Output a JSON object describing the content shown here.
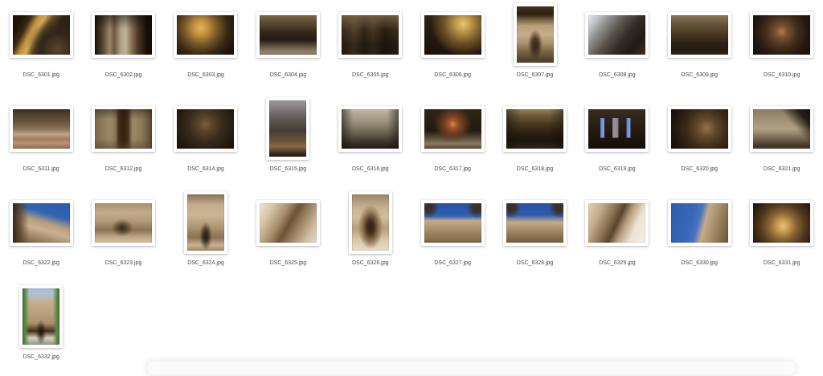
{
  "colors": {
    "page_background": "#ffffff",
    "card_background": "#ffffff",
    "label_text": "#4a4a4a"
  },
  "gallery": {
    "items": [
      {
        "filename": "DSC_6301.jpg",
        "orientation": "landscape",
        "bg": "radial-gradient(circle at 78% 85%, #5a4632 0%, #32261a 28%, rgba(0,0,0,0) 55%), linear-gradient(118deg, #1c120a 12%, #3a2a16 24%, #c08f3e 34%, #d4ab58 42%, #6b4e26 52%, #2e2114 66%, #241a10 100%)"
      },
      {
        "filename": "DSC_6302.jpg",
        "orientation": "landscape",
        "bg": "linear-gradient(180deg, rgba(12,8,5,0.5) 0%, rgba(0,0,0,0) 35%), linear-gradient(90deg, #1a100a 0%, #5a4632 14%, #9a8668 26%, #6b5840 34%, #b2a48c 46%, #c0b29a 54%, #8a7458 64%, #4a3624 76%, #140c06 92%)"
      },
      {
        "filename": "DSC_6303.jpg",
        "orientation": "landscape",
        "bg": "radial-gradient(circle at 42% 32%, #e2b558 0%, #c08f3e 18%, #7a5a28 38%, #3a2a16 62%, #1e140c 85%, #16100a 100%)"
      },
      {
        "filename": "DSC_6304.jpg",
        "orientation": "landscape",
        "bg": "linear-gradient(180deg, #7a6543 0%, #57452e 22%, #32261a 45%, #241a12 62%, #6b5c4a 82%, #93846e 94%, #7a6c58 100%)"
      },
      {
        "filename": "DSC_6305.jpg",
        "orientation": "landscape",
        "bg": "linear-gradient(180deg, rgba(122,101,70,0.85) 0%, rgba(62,48,32,0.2) 38%, rgba(20,13,8,0.5) 75%), linear-gradient(90deg, #32261a 0%, #57452e 22%, #2e2216 40%, #4a3a26 55%, #241a10 75%, #3a2c1c 100%)"
      },
      {
        "filename": "DSC_6306.jpg",
        "orientation": "landscape",
        "bg": "radial-gradient(circle at 68% 22%, #e8c870 0%, #b08a44 20%, #6b4e26 40%, rgba(0,0,0,0) 65%), linear-gradient(200deg, #4a3a22 0%, #2a1e12 45%, #18100a 100%)"
      },
      {
        "filename": "DSC_6307.jpg",
        "orientation": "portrait",
        "bg": "radial-gradient(ellipse at 50% 68%, rgba(52,34,18,0.95) 0%, rgba(52,34,18,0.8) 12%, rgba(0,0,0,0) 28%), linear-gradient(180deg, #44321e 0%, #302012 14%, #6b563a 22%, #b89e7a 34%, #c6ae8a 50%, #ae9572 64%, #7a6348 80%, #57432c 94%)"
      },
      {
        "filename": "DSC_6308.jpg",
        "orientation": "landscape",
        "bg": "linear-gradient(128deg, #e8eaec 0%, #c2c6ca 12%, #8a8a86 28%, #57524a 45%, #332c24 62%, #201a14 80%, #3a322a 100%)"
      },
      {
        "filename": "DSC_6309.jpg",
        "orientation": "landscape",
        "bg": "linear-gradient(180deg, #8a7656 0%, #6b583c 20%, #4a3a26 45%, #2e2216 70%, #241a10 88%, #32261a 100%)"
      },
      {
        "filename": "DSC_6310.jpg",
        "orientation": "landscape",
        "bg": "radial-gradient(circle at 50% 42%, #b07c48 0%, #7a5230 16%, #44301c 42%, #241812 70%, #160e08 100%)"
      },
      {
        "filename": "DSC_6311.jpg",
        "orientation": "landscape",
        "bg": "linear-gradient(180deg, #3a2c1c 0%, #57452e 18%, #6b5840 34%, #8a7456 50%, #c0a488 64%, #a87a5e 76%, #b89478 86%, #93674e 100%)"
      },
      {
        "filename": "DSC_6312.jpg",
        "orientation": "landscape",
        "bg": "linear-gradient(180deg, rgba(40,28,16,0.5) 0%, rgba(0,0,0,0) 25%, rgba(0,0,0,0) 75%, rgba(90,70,46,0.6) 100%), linear-gradient(90deg, #7a6848 0%, #9c8968 26%, #8a7656 36%, #442c16 42%, #32200e 50%, #442c16 58%, #9c8968 66%, #8a7656 84%, #57452e 100%)"
      },
      {
        "filename": "DSC_6314.jpg",
        "orientation": "landscape",
        "bg": "radial-gradient(circle at 50% 38%, #7a5e3c 0%, #57432a 20%, #3a2c1c 45%, #241a10 75%, #180f08 100%)"
      },
      {
        "filename": "DSC_6315.jpg",
        "orientation": "portrait",
        "bg": "linear-gradient(180deg, #9a9a9c 0%, #7a7674 18%, #5a5450 36%, #443c34 54%, #6b523a 72%, #8a6844 82%, #3a2c20 94%, #241a12 100%)"
      },
      {
        "filename": "DSC_6316.jpg",
        "orientation": "landscape",
        "bg": "linear-gradient(90deg, rgba(26,20,14,0.6) 0%, rgba(0,0,0,0) 20%, rgba(0,0,0,0) 80%, rgba(26,20,14,0.6) 100%), linear-gradient(180deg, #c0b8a4 0%, #a89e88 22%, #8a8270 42%, #625a4c 64%, #3a342a 84%, #201c16 100%)"
      },
      {
        "filename": "DSC_6317.jpg",
        "orientation": "landscape",
        "bg": "radial-gradient(circle at 50% 38%, #d88a50 0%, #a4552e 10%, #6b3a20 26%, rgba(0,0,0,0) 50%), linear-gradient(180deg, #2e2416 0%, #241a10 55%, #6b5c46 78%, #8a7a62 88%, #57452e 100%)"
      },
      {
        "filename": "DSC_6318.jpg",
        "orientation": "landscape",
        "bg": "linear-gradient(90deg, rgba(20,14,8,0.5) 0%, rgba(0,0,0,0) 25%, rgba(0,0,0,0) 75%, rgba(20,14,8,0.5) 100%), linear-gradient(180deg, #9a7e50 0%, #6b563a 18%, #44341e 40%, #2a1e12 62%, #1c140c 80%, #32281a 100%)"
      },
      {
        "filename": "DSC_6319.jpg",
        "orientation": "landscape",
        "bg": "linear-gradient(90deg, rgba(0,0,0,0) 0%, rgba(0,0,0,0) 16%, #5a7ec8 16%, #8aa0d4 22%, #6a8ace 24%, rgba(0,0,0,0) 24%, rgba(0,0,0,0) 40%, #6a8ace 40%, #c08a5a 46%, #5a7ec8 52%, rgba(0,0,0,0) 52%, rgba(0,0,0,0) 68%, #5a7ec8 68%, #8aa0d4 74%, #6a8ace 76%, rgba(0,0,0,0) 76%) 50% 48% / 88% 50% no-repeat, linear-gradient(180deg, #3a2e1e 0%, #2a2014 35%, #1c140c 75%, #140e08 100%)"
      },
      {
        "filename": "DSC_6320.jpg",
        "orientation": "landscape",
        "bg": "radial-gradient(circle at 62% 48%, #94744a 0%, #64492c 22%, #3a2a18 50%, #201610 80%, #160f0a 100%)"
      },
      {
        "filename": "DSC_6321.jpg",
        "orientation": "landscape",
        "bg": "linear-gradient(230deg, #16100a 0%, #241c12 14%, rgba(0,0,0,0) 34%), linear-gradient(180deg, #8a7c64 0%, #a2947a 30%, #b0a286 50%, #7a6c54 72%, #44382a 92%)"
      },
      {
        "filename": "DSC_6322.jpg",
        "orientation": "landscape",
        "bg": "linear-gradient(90deg, rgba(50,36,22,0.95) 0%, rgba(80,60,38,0.8) 12%, rgba(0,0,0,0) 28%), linear-gradient(196deg, #2a5aaa 0%, #3263b2 30%, #b89e7e 48%, #c8b192 62%, #9a8162 80%, #6b5436 100%)"
      },
      {
        "filename": "DSC_6323.jpg",
        "orientation": "landscape",
        "bg": "radial-gradient(ellipse at 48% 62%, rgba(40,26,14,0.9) 0%, rgba(40,26,14,0.55) 10%, rgba(0,0,0,0) 26%), linear-gradient(180deg, #a8906c 0%, #c2ac8c 24%, #b29a78 46%, #8a7252 68%, #bfa988 86%, #d0bc9c 100%)"
      },
      {
        "filename": "DSC_6324.jpg",
        "orientation": "portrait",
        "bg": "radial-gradient(ellipse at 50% 74%, rgba(30,20,10,0.95) 0%, rgba(30,20,10,0.7) 10%, rgba(0,0,0,0) 24%), linear-gradient(180deg, #8a7252 0%, #c2ac8c 18%, #cab494 38%, #ae9674 58%, #8a7252 76%, #c8b292 90%, #a28a68 100%)"
      },
      {
        "filename": "DSC_6325.jpg",
        "orientation": "landscape",
        "bg": "linear-gradient(120deg, #f0e6d2 0%, #d8c6a8 18%, #a88f6c 38%, #6b5436 52%, #9a8262 66%, #cdbb9e 84%, #e6dcc8 100%)"
      },
      {
        "filename": "DSC_6326.jpg",
        "orientation": "portrait",
        "bg": "radial-gradient(ellipse at 50% 58%, #2e1e10 0%, #44301a 14%, #8a7050 30%, rgba(0,0,0,0) 48%), linear-gradient(180deg, #9a8668 0%, #c4ae8e 22%, #d2bfa0 40%, #b89e7c 60%, #d8c6a8 80%, #e8dcc6 100%)"
      },
      {
        "filename": "DSC_6327.jpg",
        "orientation": "landscape",
        "bg": "radial-gradient(circle at 8% 12%, rgba(60,44,26,0.9) 0%, rgba(60,44,26,0.9) 6%, rgba(0,0,0,0) 16%), radial-gradient(circle at 92% 12%, rgba(60,44,26,0.9) 0%, rgba(60,44,26,0.9) 6%, rgba(0,0,0,0) 16%), linear-gradient(180deg, #27519e 0%, #2f5dae 26%, #3a68b8 34%, #c2ab88 44%, #b29a76 58%, #9a8160 76%, #86704e 92%, #745e40 100%)"
      },
      {
        "filename": "DSC_6328.jpg",
        "orientation": "landscape",
        "bg": "radial-gradient(circle at 8% 12%, rgba(60,44,26,0.9) 0%, rgba(60,44,26,0.9) 6%, rgba(0,0,0,0) 16%), radial-gradient(circle at 92% 12%, rgba(60,44,26,0.9) 0%, rgba(60,44,26,0.9) 6%, rgba(0,0,0,0) 16%), linear-gradient(180deg, #27519e 0%, #2f5dae 30%, #c2ab88 48%, #a8906c 66%, #8a7250 84%, #745e40 100%)"
      },
      {
        "filename": "DSC_6329.jpg",
        "orientation": "landscape",
        "bg": "linear-gradient(115deg, #e0d2b4 0%, #c2ac8a 20%, #8a7252 38%, #57452e 50%, #b89e7c 62%, #ece4d4 78%, #f4efe4 100%)"
      },
      {
        "filename": "DSC_6330.jpg",
        "orientation": "landscape",
        "bg": "linear-gradient(105deg, #2f5dae 0%, #3a68b8 38%, #4a74c0 48%, #c2ab88 58%, #a8906c 72%, #8a7250 86%, #6b5436 100%)"
      },
      {
        "filename": "DSC_6331.jpg",
        "orientation": "landscape",
        "bg": "radial-gradient(circle at 52% 58%, #e8c47a 0%, #c89a52 16%, #8a6434 36%, #50391e 60%, #2c1d10 85%, #1e130a 100%)"
      },
      {
        "filename": "DSC_6332.jpg",
        "orientation": "portrait",
        "bg": "linear-gradient(90deg, #3f6b33 0%, #5a8a46 7%, rgba(0,0,0,0) 18%, rgba(0,0,0,0) 82%, #5a8a46 93%, #3f6b33 100%), radial-gradient(ellipse at 50% 78%, rgba(25,18,10,0.95) 0%, rgba(25,18,10,0.6) 8%, rgba(0,0,0,0) 20%), linear-gradient(180deg, #a0bcd8 0%, #b2c2d2 10%, #c4ae8c 24%, #baa27e 44%, #a8906c 62%, #44301a 76%, #d8d0c0 88%, #8a9a84 100%)"
      }
    ]
  }
}
